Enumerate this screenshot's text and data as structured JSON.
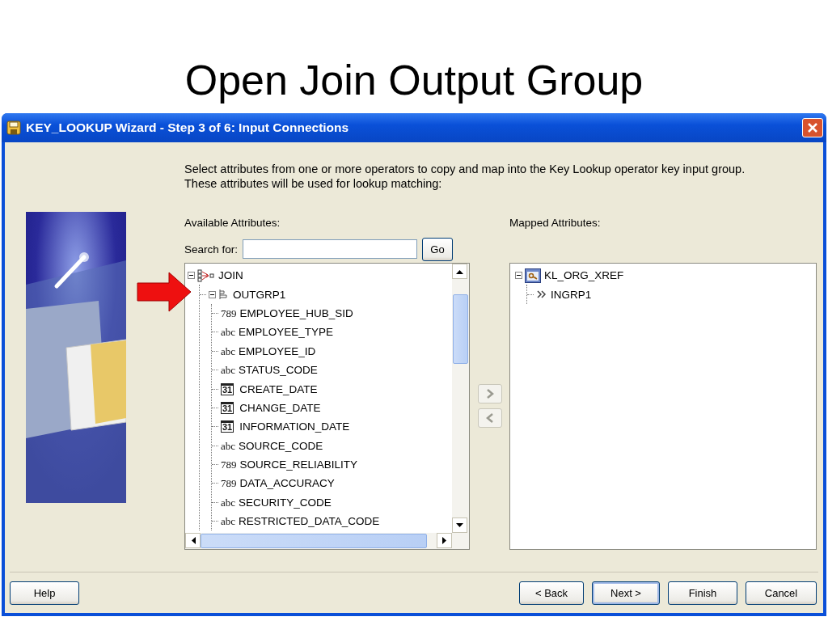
{
  "slide": {
    "title": "Open Join Output Group"
  },
  "window": {
    "title": "KEY_LOOKUP Wizard - Step 3 of 6: Input Connections"
  },
  "instructions": "Select attributes from one or more operators to copy and map into the Key Lookup operator key input group.  These attributes will be used for lookup matching:",
  "available": {
    "label": "Available Attributes:",
    "search_label": "Search for:",
    "go_button": "Go",
    "tree": [
      {
        "kind": "operator",
        "label": "JOIN",
        "expanded": true,
        "children": [
          {
            "kind": "group",
            "label": "OUTGRP1",
            "expanded": true,
            "children": [
              {
                "kind": "number",
                "type_icon": "789",
                "label": "EMPLOYEE_HUB_SID"
              },
              {
                "kind": "string",
                "type_icon": "abc",
                "label": "EMPLOYEE_TYPE"
              },
              {
                "kind": "string",
                "type_icon": "abc",
                "label": "EMPLOYEE_ID"
              },
              {
                "kind": "string",
                "type_icon": "abc",
                "label": "STATUS_CODE"
              },
              {
                "kind": "date",
                "type_icon": "31",
                "label": "CREATE_DATE"
              },
              {
                "kind": "date",
                "type_icon": "31",
                "label": "CHANGE_DATE"
              },
              {
                "kind": "date",
                "type_icon": "31",
                "label": "INFORMATION_DATE"
              },
              {
                "kind": "string",
                "type_icon": "abc",
                "label": "SOURCE_CODE"
              },
              {
                "kind": "number",
                "type_icon": "789",
                "label": "SOURCE_RELIABILITY"
              },
              {
                "kind": "number",
                "type_icon": "789",
                "label": "DATA_ACCURACY"
              },
              {
                "kind": "string",
                "type_icon": "abc",
                "label": "SECURITY_CODE"
              },
              {
                "kind": "string",
                "type_icon": "abc",
                "label": "RESTRICTED_DATA_CODE"
              }
            ]
          }
        ]
      }
    ]
  },
  "mapped": {
    "label": "Mapped Attributes:",
    "tree": [
      {
        "kind": "table",
        "label": "KL_ORG_XREF",
        "expanded": true,
        "children": [
          {
            "kind": "input_group",
            "label": "INGRP1"
          }
        ]
      }
    ]
  },
  "footer": {
    "help_button": "Help",
    "buttons": [
      {
        "label": "< Back",
        "default": false
      },
      {
        "label": "Next >",
        "default": true
      },
      {
        "label": "Finish",
        "default": false
      },
      {
        "label": "Cancel",
        "default": false
      }
    ]
  }
}
